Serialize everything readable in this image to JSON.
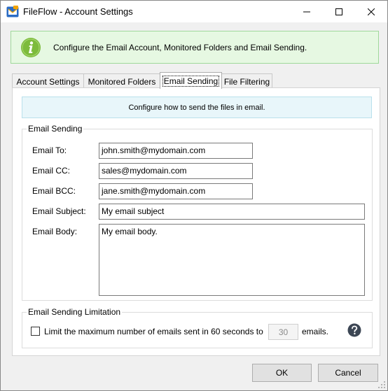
{
  "window": {
    "title": "FileFlow - Account Settings",
    "controls": {
      "minimize": "minimize-icon",
      "maximize": "maximize-icon",
      "close": "close-icon"
    }
  },
  "banner": {
    "icon": "info-icon",
    "text": "Configure the Email Account, Monitored Folders and Email Sending.",
    "accent": "#7dbb3c"
  },
  "tabs": [
    {
      "label": "Account Settings",
      "active": false
    },
    {
      "label": "Monitored Folders",
      "active": false
    },
    {
      "label": "Email Sending",
      "active": true
    },
    {
      "label": "File Filtering",
      "active": false
    }
  ],
  "panel": {
    "info": "Configure how to send the files in email.",
    "email_sending": {
      "title": "Email Sending",
      "fields": [
        {
          "label": "Email To:",
          "value": "john.smith@mydomain.com"
        },
        {
          "label": "Email CC:",
          "value": "sales@mydomain.com"
        },
        {
          "label": "Email BCC:",
          "value": "jane.smith@mydomain.com"
        },
        {
          "label": "Email Subject:",
          "value": "My email subject"
        },
        {
          "label": "Email Body:",
          "value": "My email body."
        }
      ]
    },
    "limitation": {
      "title": "Email Sending Limitation",
      "checkbox_checked": false,
      "label_before": "Limit the maximum number of emails sent in 60 seconds to",
      "value": "30",
      "label_after": "emails.",
      "help_icon": "help-icon"
    }
  },
  "buttons": {
    "ok": "OK",
    "cancel": "Cancel"
  }
}
